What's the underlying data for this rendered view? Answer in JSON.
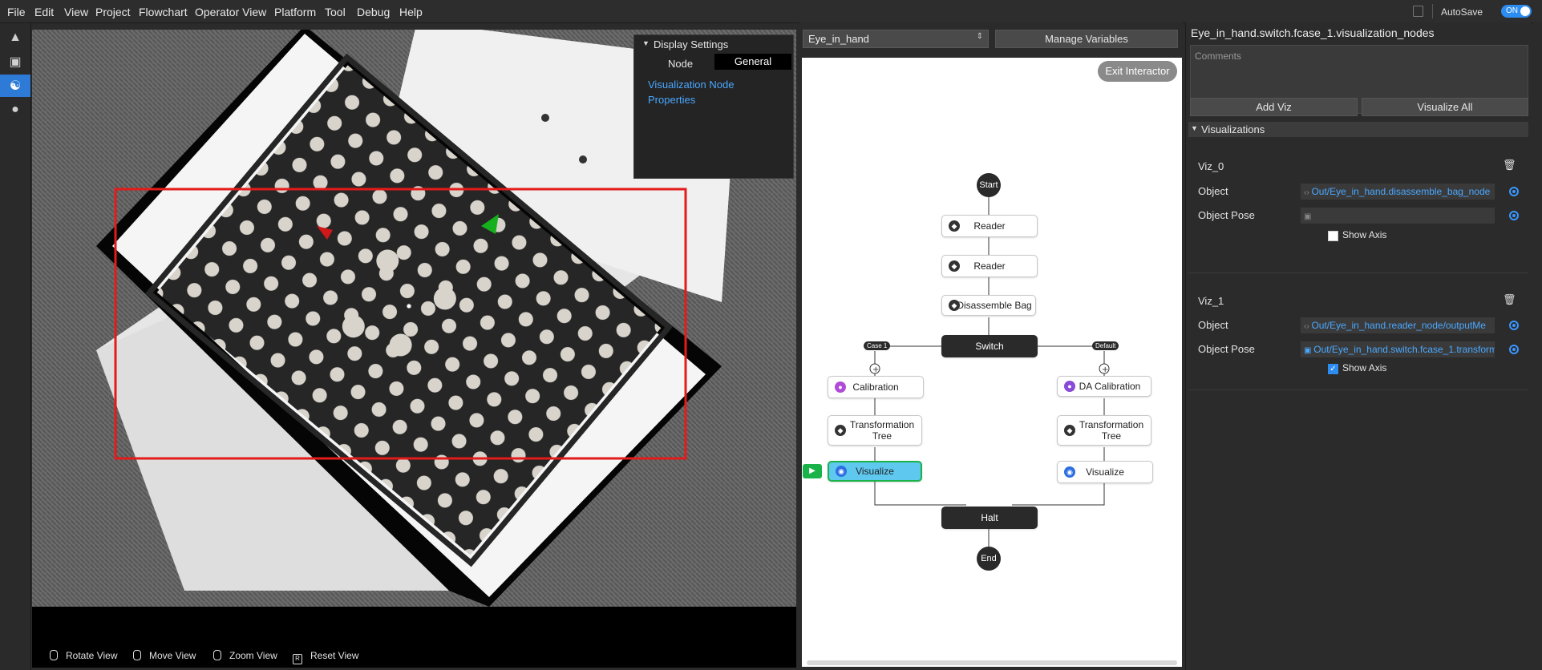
{
  "menu": [
    "File",
    "Edit",
    "View",
    "Project",
    "Flowchart",
    "Operator View",
    "Platform",
    "Tool",
    "Debug",
    "Help"
  ],
  "autosave": {
    "label": "AutoSave",
    "toggle": "ON"
  },
  "viewport": {
    "display_settings": {
      "title": "Display Settings",
      "tabs": [
        "Node",
        "General"
      ],
      "link": "Visualization Node Properties"
    },
    "bottom": {
      "rotate": "Rotate View",
      "move": "Move View",
      "zoom": "Zoom View",
      "reset_key": "R",
      "reset": "Reset View"
    }
  },
  "flowchart": {
    "selector": "Eye_in_hand",
    "manage_variables": "Manage Variables",
    "exit_interactor": "Exit Interactor",
    "nodes": {
      "start": "Start",
      "reader1": "Reader",
      "reader2": "Reader",
      "disassemble": "Disassemble Bag",
      "switch": "Switch",
      "case_tag": "Case 1",
      "default_tag": "Default",
      "calibration": "Calibration",
      "tt_left": "Transformation Tree",
      "viz_left": "Visualize",
      "da_calibration": "DA Calibration",
      "tt_right": "Transformation Tree",
      "viz_right": "Visualize",
      "halt": "Halt",
      "end": "End"
    }
  },
  "inspector": {
    "title": "Eye_in_hand.switch.fcase_1.visualization_nodes",
    "comments_placeholder": "Comments",
    "add_viz": "Add Viz",
    "visualize_all": "Visualize All",
    "section": "Visualizations",
    "viz": [
      {
        "name": "Viz_0",
        "object_label": "Object",
        "object": "Out/Eye_in_hand.disassemble_bag_node",
        "pose_label": "Object Pose",
        "pose": "",
        "show_axis": "Show Axis",
        "show_axis_checked": false
      },
      {
        "name": "Viz_1",
        "object_label": "Object",
        "object": "Out/Eye_in_hand.reader_node/outputMe",
        "pose_label": "Object Pose",
        "pose": "Out/Eye_in_hand.switch.fcase_1.transform",
        "show_axis": "Show Axis",
        "show_axis_checked": true
      }
    ]
  },
  "colors": {
    "accent": "#2d7bd6",
    "link": "#4aa8ff",
    "active_node": "#5ec8ef",
    "roi": "#e31b1b"
  }
}
